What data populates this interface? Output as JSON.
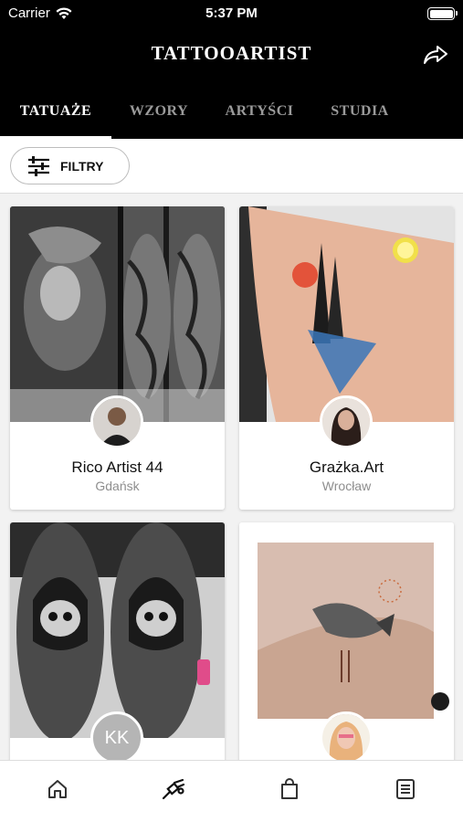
{
  "status_bar": {
    "carrier": "Carrier",
    "time": "5:37 PM"
  },
  "header": {
    "title": "TATTOOARTIST",
    "share_icon": "share-arrow-icon"
  },
  "tabs": [
    {
      "label": "TATUAŻE",
      "active": true
    },
    {
      "label": "WZORY",
      "active": false
    },
    {
      "label": "ARTYŚCI",
      "active": false
    },
    {
      "label": "STUDIA",
      "active": false
    }
  ],
  "filter": {
    "label": "FILTRY",
    "icon": "sliders-icon"
  },
  "cards": [
    {
      "name": "Rico Artist 44",
      "city": "Gdańsk"
    },
    {
      "name": "Grażka.Art",
      "city": "Wrocław"
    },
    {
      "name": "",
      "city": "",
      "avatar_initials": "KK"
    },
    {
      "name": "",
      "city": ""
    }
  ],
  "bottom_nav": [
    {
      "icon": "home-icon"
    },
    {
      "icon": "tattoo-machine-icon"
    },
    {
      "icon": "shopping-bag-icon"
    },
    {
      "icon": "list-icon"
    }
  ],
  "colors": {
    "header_bg": "#000000",
    "tab_inactive": "#9a9a9a",
    "background": "#f2f2f2"
  }
}
